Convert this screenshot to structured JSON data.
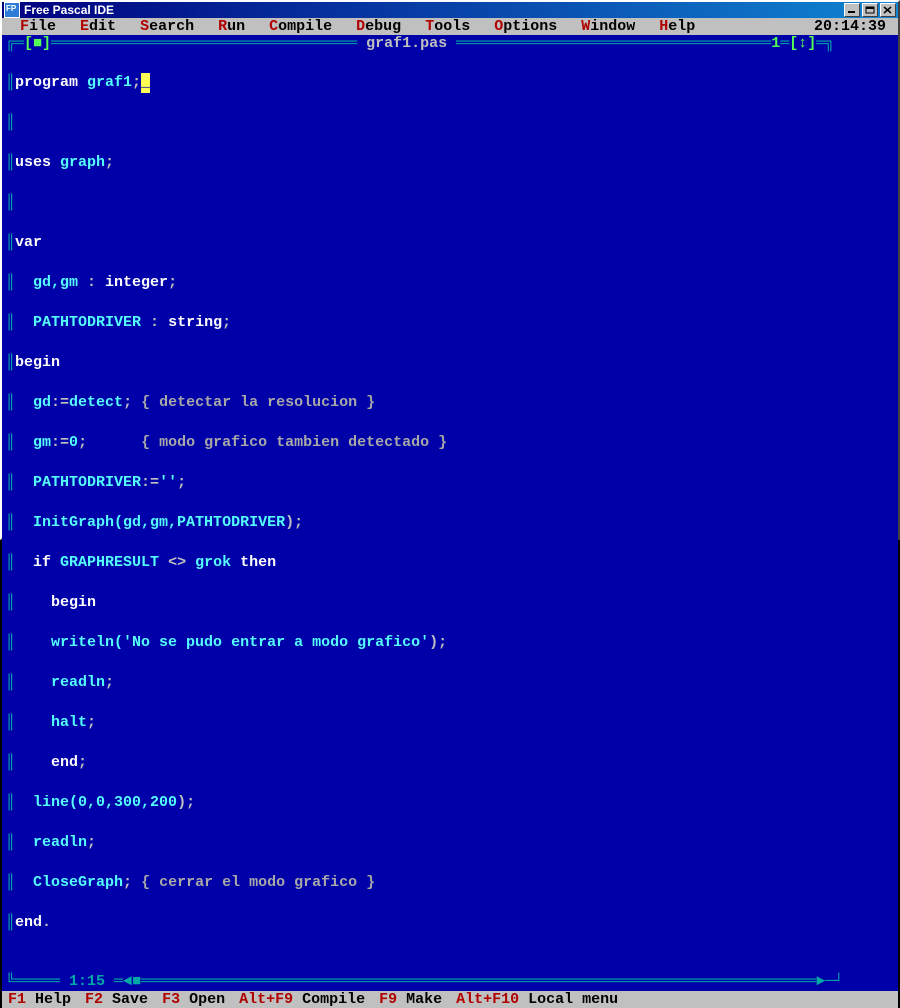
{
  "window": {
    "title": "Free Pascal IDE"
  },
  "menubar": {
    "items": [
      {
        "hot": "F",
        "rest": "ile"
      },
      {
        "hot": "E",
        "rest": "dit"
      },
      {
        "hot": "S",
        "rest": "earch"
      },
      {
        "hot": "R",
        "rest": "un"
      },
      {
        "hot": "C",
        "rest": "ompile"
      },
      {
        "hot": "D",
        "rest": "ebug"
      },
      {
        "hot": "T",
        "rest": "ools"
      },
      {
        "hot": "O",
        "rest": "ptions"
      },
      {
        "hot": "W",
        "rest": "indow"
      },
      {
        "hot": "H",
        "rest": "elp"
      }
    ],
    "clock": "20:14:39"
  },
  "editor": {
    "close_glyph": "[■]",
    "title": " graf1.pas ",
    "window_num": "1",
    "scroll_ud": "[↕]",
    "cursor_pos": "1:15",
    "scroll_left": "◄",
    "scroll_block": "■",
    "scroll_right": "►",
    "code": {
      "l1_kw": "program",
      "l1_id": " graf1",
      "l1_sc": ";",
      "l2_kw": "uses",
      "l2_id": " graph",
      "l2_sc": ";",
      "l3_kw": "var",
      "l4_id": "  gd,gm ",
      "l4_sym": ": ",
      "l4_type": "integer",
      "l4_sc": ";",
      "l5_id": "  PATHTODRIVER ",
      "l5_sym": ": ",
      "l5_type": "string",
      "l5_sc": ";",
      "l6_kw": "begin",
      "l7_id": "  gd",
      "l7_asn": ":=",
      "l7_v": "detect",
      "l7_sc": ";",
      "l7_cm": " { detectar la resolucion }",
      "l8_id": "  gm",
      "l8_asn": ":=",
      "l8_v": "0",
      "l8_sc": ";",
      "l8_sp": "      ",
      "l8_cm": "{ modo grafico tambien detectado }",
      "l9_id": "  PATHTODRIVER",
      "l9_asn": ":=",
      "l9_v": "''",
      "l9_sc": ";",
      "l10_id": "  InitGraph(",
      "l10_a": "gd,gm,PATHTODRIVER",
      "l10_cl": ")",
      "l10_sc": ";",
      "l11_kw": "  if",
      "l11_id": " GRAPHRESULT ",
      "l11_op": "<> ",
      "l11_v": "grok ",
      "l11_kw2": "then",
      "l12_kw": "    begin",
      "l13_id": "    writeln(",
      "l13_str": "'No se pudo entrar a modo grafico'",
      "l13_cl": ")",
      "l13_sc": ";",
      "l14_id": "    readln",
      "l14_sc": ";",
      "l15_id": "    halt",
      "l15_sc": ";",
      "l16_kw": "    end",
      "l16_sc": ";",
      "l17_id": "  line(",
      "l17_a": "0,0,300,200",
      "l17_cl": ")",
      "l17_sc": ";",
      "l18_id": "  readln",
      "l18_sc": ";",
      "l19_id": "  CloseGraph",
      "l19_sc": ";",
      "l19_cm": " { cerrar el modo grafico }",
      "l20_kw": "end",
      "l20_dot": "."
    }
  },
  "statusbar": {
    "items": [
      {
        "fkey": "F1",
        "label": " Help"
      },
      {
        "fkey": "F2",
        "label": " Save"
      },
      {
        "fkey": "F3",
        "label": " Open"
      },
      {
        "fkey": "Alt+F9",
        "label": " Compile"
      },
      {
        "fkey": "F9",
        "label": " Make"
      },
      {
        "fkey": "Alt+F10",
        "label": " Local menu"
      }
    ]
  }
}
